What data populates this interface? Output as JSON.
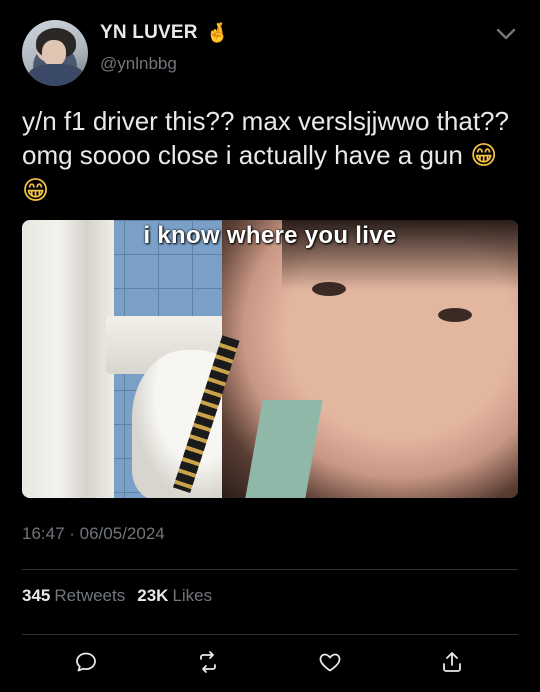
{
  "user": {
    "display_name": "YN LUVER",
    "name_emoji": "🤞",
    "handle": "@ynlnbbg"
  },
  "tweet": {
    "text": "y/n f1 driver this?? max verslsjjwwo that?? omg soooo close i actually have a gun",
    "emoji": "😁😁",
    "media_caption": "i know where you live",
    "timestamp": "16:47 · 06/05/2024"
  },
  "stats": {
    "retweets_count": "345",
    "retweets_label": "Retweets",
    "likes_count": "23K",
    "likes_label": "Likes"
  },
  "icons": {
    "more": "chevron-down-icon",
    "reply": "reply-icon",
    "retweet": "retweet-icon",
    "like": "heart-icon",
    "share": "share-icon"
  },
  "colors": {
    "background": "#000000",
    "text": "#e7e9ea",
    "secondary": "#71767b",
    "divider": "#2f3336"
  }
}
